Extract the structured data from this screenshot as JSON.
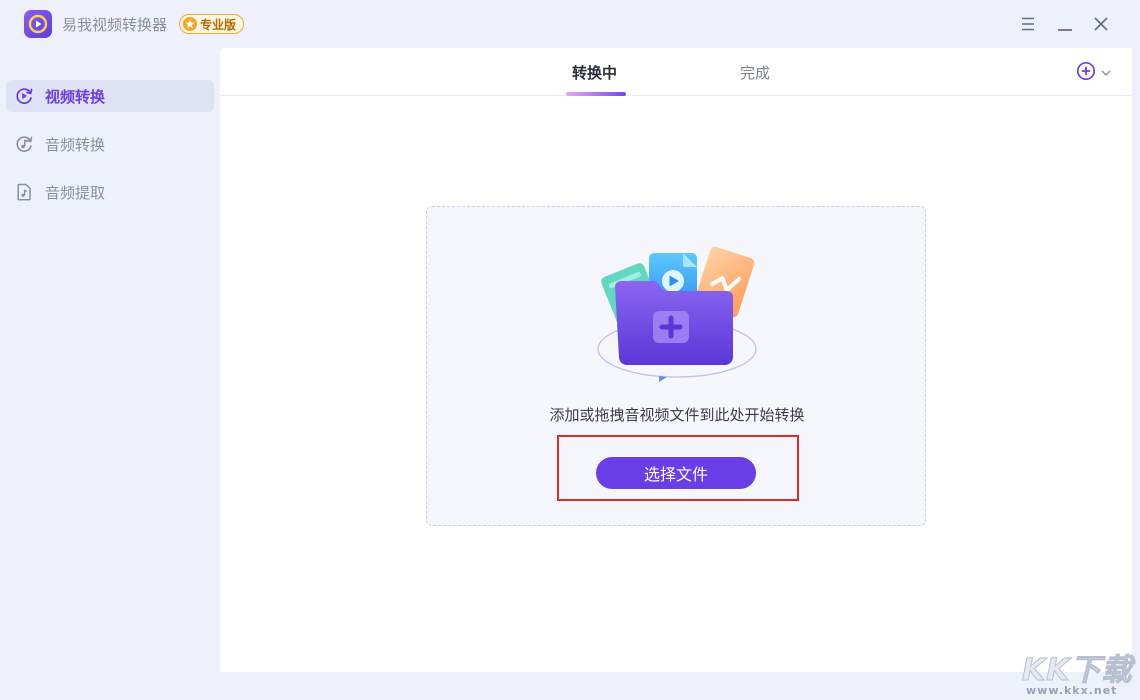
{
  "app": {
    "title": "易我视频转换器",
    "badge": "专业版",
    "logo_icon": "play-circle-icon",
    "accent_color": "#6a3ee6"
  },
  "window_controls": {
    "menu_icon": "hamburger-menu-icon",
    "minimize_icon": "minimize-icon",
    "close_icon": "close-icon"
  },
  "sidebar": {
    "items": [
      {
        "label": "视频转换",
        "icon": "video-convert-icon",
        "active": true
      },
      {
        "label": "音频转换",
        "icon": "audio-convert-icon",
        "active": false
      },
      {
        "label": "音频提取",
        "icon": "audio-extract-icon",
        "active": false
      }
    ]
  },
  "main": {
    "tabs": [
      {
        "label": "转换中",
        "active": true
      },
      {
        "label": "完成",
        "active": false
      }
    ],
    "add_icon": "add-circle-icon",
    "dropdown_icon": "chevron-down-icon"
  },
  "dropzone": {
    "illustration": "folder-add-files-illustration",
    "hint": "添加或拖拽音视频文件到此处开始转换",
    "button_label": "选择文件"
  },
  "watermark": {
    "logo_text": "KK下载",
    "url": "www.kkx.net"
  }
}
